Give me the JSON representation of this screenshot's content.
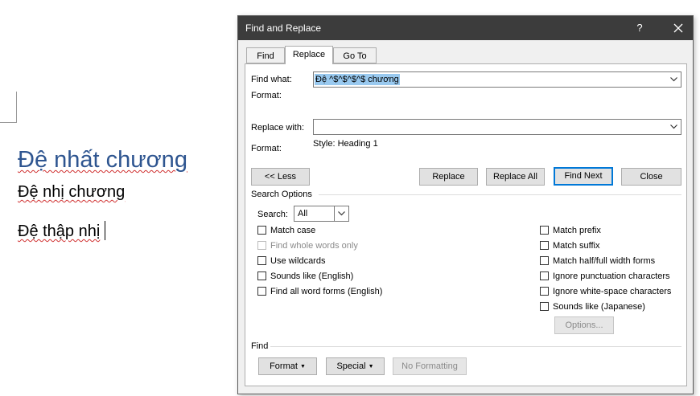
{
  "document": {
    "heading": "Đệ nhất chương",
    "line2": "Đệ nhị chương",
    "line3": "Đệ thập nhị"
  },
  "dialog": {
    "title": "Find and Replace",
    "help": "?",
    "tabs": [
      {
        "label": "Find",
        "active": false
      },
      {
        "label": "Replace",
        "active": true
      },
      {
        "label": "Go To",
        "active": false
      }
    ],
    "find_what_label": "Find what:",
    "find_what_value": "Đệ ^$^$^$^$ chương",
    "find_format_label": "Format:",
    "replace_with_label": "Replace with:",
    "replace_with_value": "",
    "replace_format_label": "Format:",
    "replace_format_value": "Style: Heading 1",
    "buttons": {
      "less": "<< Less",
      "replace": "Replace",
      "replace_all": "Replace All",
      "find_next": "Find Next",
      "close": "Close",
      "options": "Options...",
      "format": "Format",
      "special": "Special",
      "no_formatting": "No Formatting"
    },
    "search_options_label": "Search Options",
    "search_label": "Search:",
    "search_value": "All",
    "left_options": [
      {
        "label": "Match case",
        "checked": false,
        "disabled": false
      },
      {
        "label": "Find whole words only",
        "checked": false,
        "disabled": true
      },
      {
        "label": "Use wildcards",
        "checked": false,
        "disabled": false
      },
      {
        "label": "Sounds like (English)",
        "checked": false,
        "disabled": false
      },
      {
        "label": "Find all word forms (English)",
        "checked": false,
        "disabled": false
      }
    ],
    "right_options": [
      {
        "label": "Match prefix",
        "checked": false
      },
      {
        "label": "Match suffix",
        "checked": false
      },
      {
        "label": "Match half/full width forms",
        "checked": false
      },
      {
        "label": "Ignore punctuation characters",
        "checked": false
      },
      {
        "label": "Ignore white-space characters",
        "checked": false
      },
      {
        "label": "Sounds like (Japanese)",
        "checked": false
      }
    ],
    "find_section_label": "Find",
    "colors": {
      "titlebar": "#3c3c3c",
      "accent": "#0078d7",
      "selection": "#99c9ef",
      "heading_text": "#2e5590"
    }
  }
}
